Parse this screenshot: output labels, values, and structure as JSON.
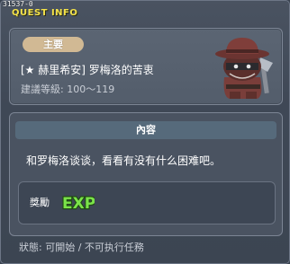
{
  "window": {
    "quest_id": "31537-0",
    "title": "QUEST INFO"
  },
  "quest": {
    "category_badge": "主要",
    "name": "[★ 赫里希安] 罗梅洛的苦衷",
    "level_label": "建議等級: 100～119"
  },
  "content": {
    "header": "內容",
    "text": "和罗梅洛谈谈，看看有没有什么困难吧。"
  },
  "reward": {
    "label": "獎勵",
    "item": "EXP"
  },
  "status": {
    "text": "狀態: 可開始 / 不可执行任務"
  },
  "colors": {
    "title": "#f4e34a",
    "exp_fill": "#7be34a",
    "exp_outline": "#1f4a12",
    "badge_bg": "#d1b994"
  },
  "npc": {
    "icon": "masked-bandit-npc-portrait"
  }
}
